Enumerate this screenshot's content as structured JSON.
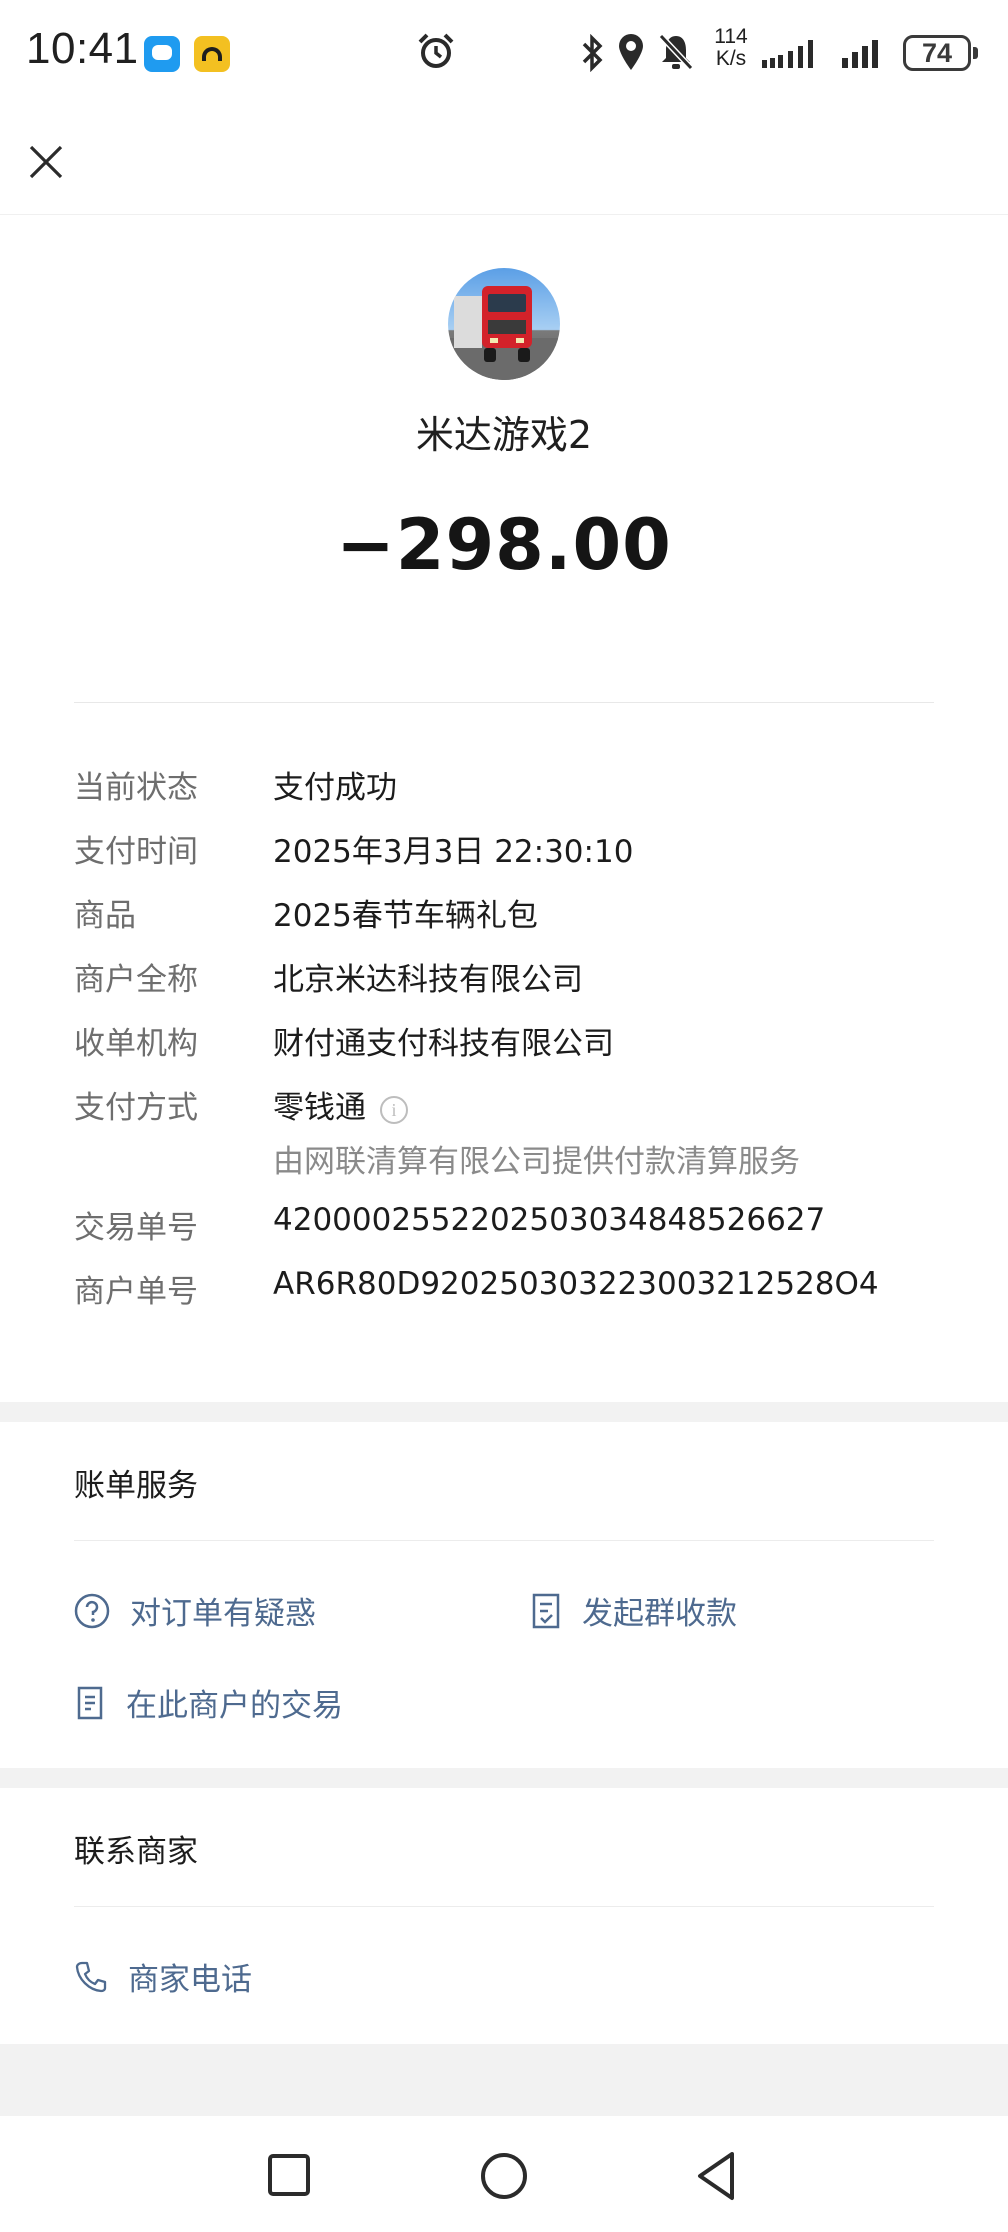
{
  "status_bar": {
    "time": "10:41",
    "net_speed_value": "114",
    "net_speed_unit": "K/s",
    "battery": "74",
    "icons": [
      "message-app-icon",
      "car-app-icon",
      "alarm-icon",
      "bluetooth-icon",
      "location-icon",
      "mute-bell-icon",
      "signal-icon",
      "signal-icon",
      "battery-icon"
    ]
  },
  "header": {
    "close_icon": "close-icon"
  },
  "merchant": {
    "name": "米达游戏2",
    "amount": "−298.00",
    "avatar_icon": "truck-avatar"
  },
  "details": [
    {
      "label": "当前状态",
      "value": "支付成功"
    },
    {
      "label": "支付时间",
      "value": "2025年3月3日 22:30:10"
    },
    {
      "label": "商品",
      "value": "2025春节车辆礼包"
    },
    {
      "label": "商户全称",
      "value": "北京米达科技有限公司"
    },
    {
      "label": "收单机构",
      "value": "财付通支付科技有限公司"
    },
    {
      "label": "支付方式",
      "value": "零钱通",
      "sub": "由网联清算有限公司提供付款清算服务"
    },
    {
      "label": "交易单号",
      "value": "4200002552202503034848526627"
    },
    {
      "label": "商户单号",
      "value": "AR6R80D920250303223003212528O4"
    }
  ],
  "bill_service": {
    "title": "账单服务",
    "links": [
      {
        "label": "对订单有疑惑",
        "icon": "question-circle-icon"
      },
      {
        "label": "发起群收款",
        "icon": "group-collect-icon"
      },
      {
        "label": "在此商户的交易",
        "icon": "document-icon"
      }
    ]
  },
  "contact": {
    "title": "联系商家",
    "phone_label": "商家电话",
    "phone_icon": "phone-icon"
  },
  "nav": {
    "buttons": [
      "recent-apps-icon",
      "home-icon",
      "back-icon"
    ]
  },
  "colors": {
    "link": "#4e6a8f",
    "label": "#6e6e6e",
    "band": "#f2f2f2"
  }
}
